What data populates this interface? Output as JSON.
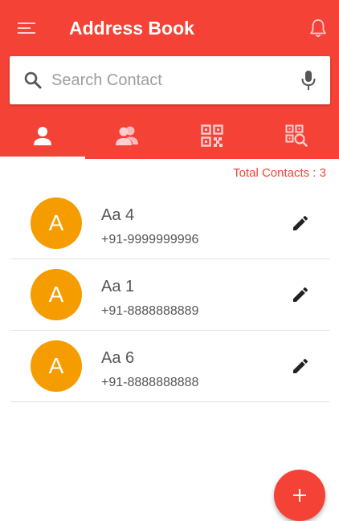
{
  "app": {
    "title": "Address Book",
    "accent": "#f44336",
    "avatar_color": "#f59c00"
  },
  "header": {
    "menu_icon": "menu-icon",
    "bell_icon": "bell-icon"
  },
  "search": {
    "placeholder": "Search Contact",
    "value": "",
    "search_icon": "search-icon",
    "mic_icon": "mic-icon"
  },
  "tabs": [
    {
      "name": "contacts",
      "icon": "person-icon",
      "selected": true
    },
    {
      "name": "groups",
      "icon": "group-icon",
      "selected": false
    },
    {
      "name": "qr-code",
      "icon": "qr-code-icon",
      "selected": false
    },
    {
      "name": "qr-scan",
      "icon": "qr-search-icon",
      "selected": false
    }
  ],
  "summary": {
    "total_contacts": "Total Contacts : 3"
  },
  "contacts": [
    {
      "initial": "A",
      "name": "Aa 4",
      "phone": "+91-9999999996",
      "edit_icon": "edit-icon"
    },
    {
      "initial": "A",
      "name": "Aa 1",
      "phone": "+91-8888888889",
      "edit_icon": "edit-icon"
    },
    {
      "initial": "A",
      "name": "Aa 6",
      "phone": "+91-8888888888",
      "edit_icon": "edit-icon"
    }
  ],
  "fab": {
    "icon": "plus-icon"
  }
}
